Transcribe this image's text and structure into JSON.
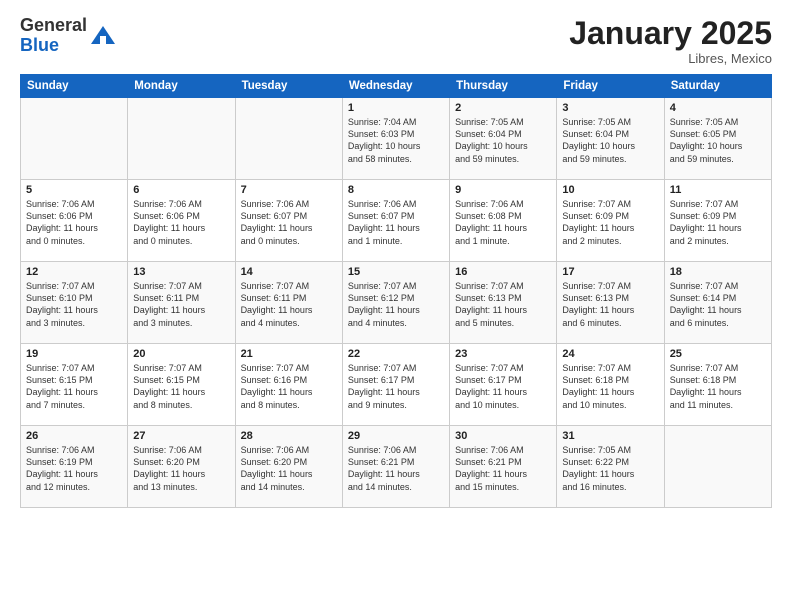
{
  "logo": {
    "general": "General",
    "blue": "Blue"
  },
  "header": {
    "month": "January 2025",
    "location": "Libres, Mexico"
  },
  "weekdays": [
    "Sunday",
    "Monday",
    "Tuesday",
    "Wednesday",
    "Thursday",
    "Friday",
    "Saturday"
  ],
  "weeks": [
    [
      {
        "day": "",
        "info": ""
      },
      {
        "day": "",
        "info": ""
      },
      {
        "day": "",
        "info": ""
      },
      {
        "day": "1",
        "info": "Sunrise: 7:04 AM\nSunset: 6:03 PM\nDaylight: 10 hours\nand 58 minutes."
      },
      {
        "day": "2",
        "info": "Sunrise: 7:05 AM\nSunset: 6:04 PM\nDaylight: 10 hours\nand 59 minutes."
      },
      {
        "day": "3",
        "info": "Sunrise: 7:05 AM\nSunset: 6:04 PM\nDaylight: 10 hours\nand 59 minutes."
      },
      {
        "day": "4",
        "info": "Sunrise: 7:05 AM\nSunset: 6:05 PM\nDaylight: 10 hours\nand 59 minutes."
      }
    ],
    [
      {
        "day": "5",
        "info": "Sunrise: 7:06 AM\nSunset: 6:06 PM\nDaylight: 11 hours\nand 0 minutes."
      },
      {
        "day": "6",
        "info": "Sunrise: 7:06 AM\nSunset: 6:06 PM\nDaylight: 11 hours\nand 0 minutes."
      },
      {
        "day": "7",
        "info": "Sunrise: 7:06 AM\nSunset: 6:07 PM\nDaylight: 11 hours\nand 0 minutes."
      },
      {
        "day": "8",
        "info": "Sunrise: 7:06 AM\nSunset: 6:07 PM\nDaylight: 11 hours\nand 1 minute."
      },
      {
        "day": "9",
        "info": "Sunrise: 7:06 AM\nSunset: 6:08 PM\nDaylight: 11 hours\nand 1 minute."
      },
      {
        "day": "10",
        "info": "Sunrise: 7:07 AM\nSunset: 6:09 PM\nDaylight: 11 hours\nand 2 minutes."
      },
      {
        "day": "11",
        "info": "Sunrise: 7:07 AM\nSunset: 6:09 PM\nDaylight: 11 hours\nand 2 minutes."
      }
    ],
    [
      {
        "day": "12",
        "info": "Sunrise: 7:07 AM\nSunset: 6:10 PM\nDaylight: 11 hours\nand 3 minutes."
      },
      {
        "day": "13",
        "info": "Sunrise: 7:07 AM\nSunset: 6:11 PM\nDaylight: 11 hours\nand 3 minutes."
      },
      {
        "day": "14",
        "info": "Sunrise: 7:07 AM\nSunset: 6:11 PM\nDaylight: 11 hours\nand 4 minutes."
      },
      {
        "day": "15",
        "info": "Sunrise: 7:07 AM\nSunset: 6:12 PM\nDaylight: 11 hours\nand 4 minutes."
      },
      {
        "day": "16",
        "info": "Sunrise: 7:07 AM\nSunset: 6:13 PM\nDaylight: 11 hours\nand 5 minutes."
      },
      {
        "day": "17",
        "info": "Sunrise: 7:07 AM\nSunset: 6:13 PM\nDaylight: 11 hours\nand 6 minutes."
      },
      {
        "day": "18",
        "info": "Sunrise: 7:07 AM\nSunset: 6:14 PM\nDaylight: 11 hours\nand 6 minutes."
      }
    ],
    [
      {
        "day": "19",
        "info": "Sunrise: 7:07 AM\nSunset: 6:15 PM\nDaylight: 11 hours\nand 7 minutes."
      },
      {
        "day": "20",
        "info": "Sunrise: 7:07 AM\nSunset: 6:15 PM\nDaylight: 11 hours\nand 8 minutes."
      },
      {
        "day": "21",
        "info": "Sunrise: 7:07 AM\nSunset: 6:16 PM\nDaylight: 11 hours\nand 8 minutes."
      },
      {
        "day": "22",
        "info": "Sunrise: 7:07 AM\nSunset: 6:17 PM\nDaylight: 11 hours\nand 9 minutes."
      },
      {
        "day": "23",
        "info": "Sunrise: 7:07 AM\nSunset: 6:17 PM\nDaylight: 11 hours\nand 10 minutes."
      },
      {
        "day": "24",
        "info": "Sunrise: 7:07 AM\nSunset: 6:18 PM\nDaylight: 11 hours\nand 10 minutes."
      },
      {
        "day": "25",
        "info": "Sunrise: 7:07 AM\nSunset: 6:18 PM\nDaylight: 11 hours\nand 11 minutes."
      }
    ],
    [
      {
        "day": "26",
        "info": "Sunrise: 7:06 AM\nSunset: 6:19 PM\nDaylight: 11 hours\nand 12 minutes."
      },
      {
        "day": "27",
        "info": "Sunrise: 7:06 AM\nSunset: 6:20 PM\nDaylight: 11 hours\nand 13 minutes."
      },
      {
        "day": "28",
        "info": "Sunrise: 7:06 AM\nSunset: 6:20 PM\nDaylight: 11 hours\nand 14 minutes."
      },
      {
        "day": "29",
        "info": "Sunrise: 7:06 AM\nSunset: 6:21 PM\nDaylight: 11 hours\nand 14 minutes."
      },
      {
        "day": "30",
        "info": "Sunrise: 7:06 AM\nSunset: 6:21 PM\nDaylight: 11 hours\nand 15 minutes."
      },
      {
        "day": "31",
        "info": "Sunrise: 7:05 AM\nSunset: 6:22 PM\nDaylight: 11 hours\nand 16 minutes."
      },
      {
        "day": "",
        "info": ""
      }
    ]
  ],
  "colors": {
    "header_bg": "#1565c0",
    "header_text": "#ffffff",
    "odd_row": "#f9f9f9",
    "even_row": "#ffffff"
  }
}
